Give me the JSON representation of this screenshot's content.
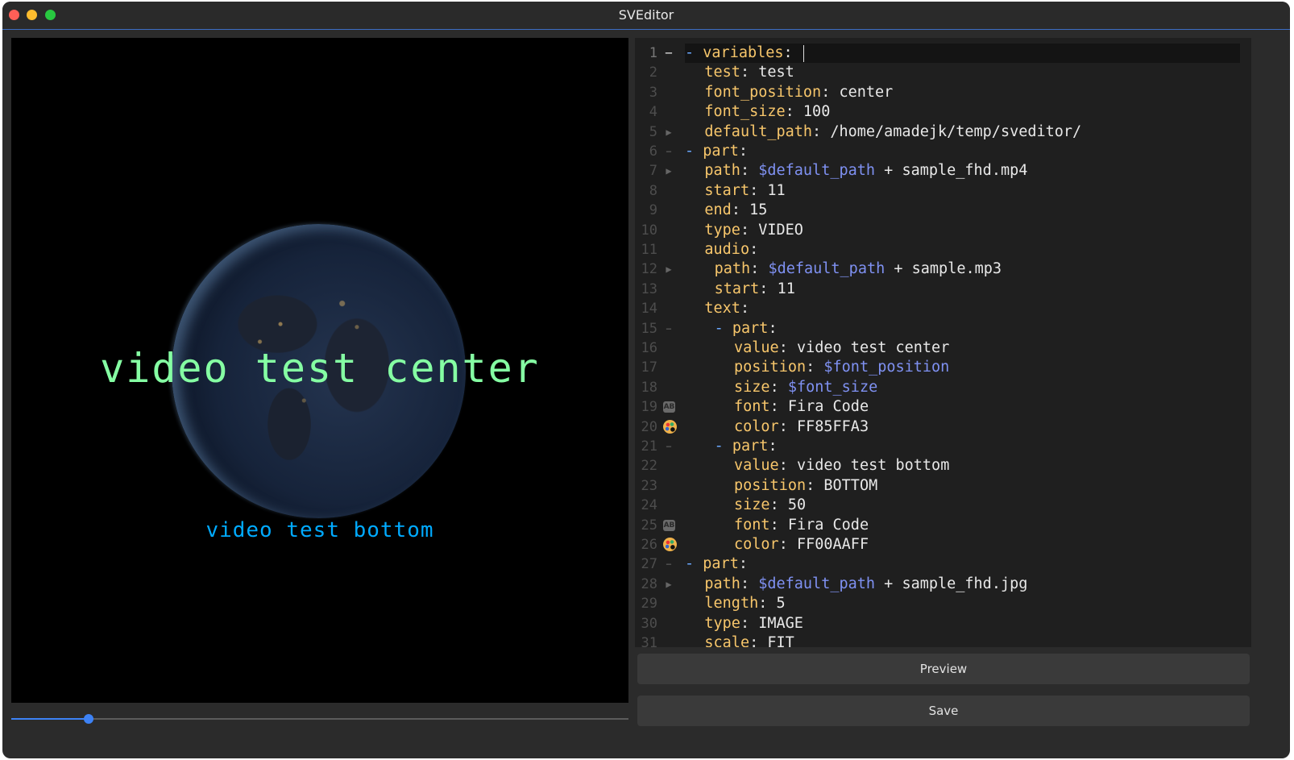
{
  "window": {
    "title": "SVEditor"
  },
  "preview": {
    "overlay_text_center": "video test center",
    "overlay_text_center_color": "#85ffa3",
    "overlay_text_bottom": "video test bottom",
    "overlay_text_bottom_color": "#00aaff",
    "timeline_progress": 0.125
  },
  "editor": {
    "lines": [
      {
        "n": "1",
        "indent": 0,
        "dash": "- ",
        "key": "variables",
        "val": "",
        "icon": "fold-open",
        "active": true
      },
      {
        "n": "2",
        "indent": 2,
        "key": "test",
        "val": "test"
      },
      {
        "n": "3",
        "indent": 2,
        "key": "font_position",
        "val": "center"
      },
      {
        "n": "4",
        "indent": 2,
        "key": "font_size",
        "val": "100"
      },
      {
        "n": "5",
        "indent": 2,
        "key": "default_path",
        "val": "/home/amadejk/temp/sveditor/",
        "icon": "run"
      },
      {
        "n": "6",
        "indent": 0,
        "dash": "- ",
        "key": "part",
        "val": "",
        "icon": "fold-open"
      },
      {
        "n": "7",
        "indent": 2,
        "key": "path",
        "var": "$default_path",
        "val": " + sample_fhd.mp4",
        "icon": "run"
      },
      {
        "n": "8",
        "indent": 2,
        "key": "start",
        "val": "11"
      },
      {
        "n": "9",
        "indent": 2,
        "key": "end",
        "val": "15"
      },
      {
        "n": "10",
        "indent": 2,
        "key": "type",
        "val": "VIDEO"
      },
      {
        "n": "11",
        "indent": 2,
        "key": "audio",
        "val": ""
      },
      {
        "n": "12",
        "indent": 3,
        "key": "path",
        "var": "$default_path",
        "val": " + sample.mp3",
        "icon": "run"
      },
      {
        "n": "13",
        "indent": 3,
        "key": "start",
        "val": "11"
      },
      {
        "n": "14",
        "indent": 2,
        "key": "text",
        "val": ""
      },
      {
        "n": "15",
        "indent": 3,
        "dash": "- ",
        "key": "part",
        "val": "",
        "icon": "fold-open"
      },
      {
        "n": "16",
        "indent": 5,
        "key": "value",
        "val": "video test center"
      },
      {
        "n": "17",
        "indent": 5,
        "key": "position",
        "var": "$font_position",
        "val": ""
      },
      {
        "n": "18",
        "indent": 5,
        "key": "size",
        "var": "$font_size",
        "val": ""
      },
      {
        "n": "19",
        "indent": 5,
        "key": "font",
        "val": "Fira Code",
        "icon": "font"
      },
      {
        "n": "20",
        "indent": 5,
        "key": "color",
        "val": "FF85FFA3",
        "icon": "palette"
      },
      {
        "n": "21",
        "indent": 3,
        "dash": "- ",
        "key": "part",
        "val": "",
        "icon": "fold-open"
      },
      {
        "n": "22",
        "indent": 5,
        "key": "value",
        "val": "video test bottom"
      },
      {
        "n": "23",
        "indent": 5,
        "key": "position",
        "val": "BOTTOM"
      },
      {
        "n": "24",
        "indent": 5,
        "key": "size",
        "val": "50"
      },
      {
        "n": "25",
        "indent": 5,
        "key": "font",
        "val": "Fira Code",
        "icon": "font"
      },
      {
        "n": "26",
        "indent": 5,
        "key": "color",
        "val": "FF00AAFF",
        "icon": "palette"
      },
      {
        "n": "27",
        "indent": 0,
        "dash": "- ",
        "key": "part",
        "val": "",
        "icon": "fold-open"
      },
      {
        "n": "28",
        "indent": 2,
        "key": "path",
        "var": "$default_path",
        "val": " + sample_fhd.jpg",
        "icon": "run"
      },
      {
        "n": "29",
        "indent": 2,
        "key": "length",
        "val": "5"
      },
      {
        "n": "30",
        "indent": 2,
        "key": "type",
        "val": "IMAGE"
      },
      {
        "n": "31",
        "indent": 2,
        "key": "scale",
        "val": "FIT"
      }
    ]
  },
  "buttons": {
    "preview": "Preview",
    "save": "Save"
  },
  "icons": {
    "fold-open": "−",
    "run": "▶",
    "font": "AB",
    "palette": "palette"
  }
}
